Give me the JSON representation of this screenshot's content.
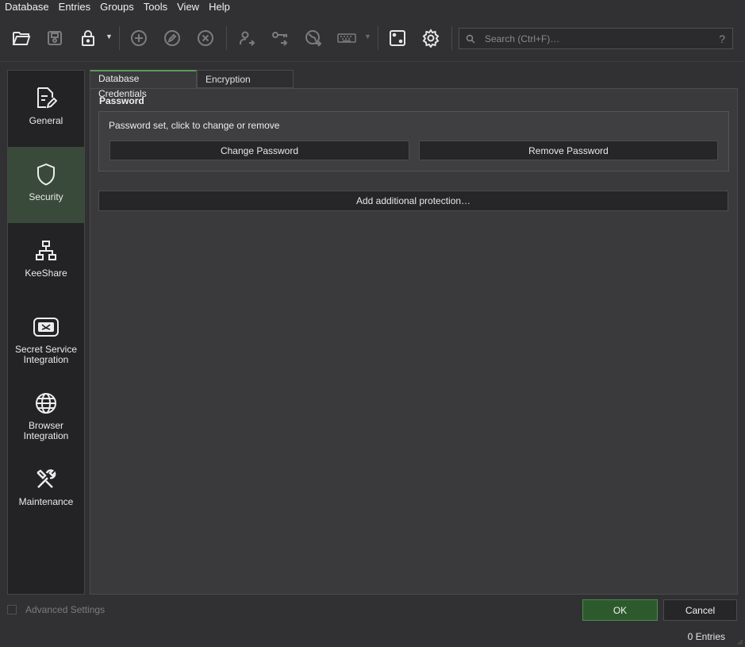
{
  "menu": [
    "Database",
    "Entries",
    "Groups",
    "Tools",
    "View",
    "Help"
  ],
  "toolbar": {
    "icons": [
      "open-database-icon",
      "save-database-icon",
      "lock-database-icon",
      "add-entry-icon",
      "edit-entry-icon",
      "delete-entry-icon",
      "copy-username-icon",
      "copy-password-icon",
      "open-url-icon",
      "autotype-icon",
      "password-generator-icon",
      "settings-icon"
    ],
    "search_placeholder": "Search (Ctrl+F)…",
    "help": "?"
  },
  "sidebar": {
    "items": [
      {
        "label": "General",
        "icon": "document-edit-icon"
      },
      {
        "label": "Security",
        "icon": "shield-icon",
        "active": true
      },
      {
        "label": "KeeShare",
        "icon": "network-icon"
      },
      {
        "label": "Secret Service Integration",
        "icon": "secret-service-icon"
      },
      {
        "label": "Browser Integration",
        "icon": "globe-icon"
      },
      {
        "label": "Maintenance",
        "icon": "tools-icon"
      }
    ]
  },
  "tabs": [
    {
      "label": "Database Credentials",
      "active": true
    },
    {
      "label": "Encryption Settings",
      "active": false
    }
  ],
  "password": {
    "title": "Password",
    "status": "Password set, click to change or remove",
    "change_label": "Change Password",
    "remove_label": "Remove Password"
  },
  "add_protection_label": "Add additional protection…",
  "advanced_settings_label": "Advanced Settings",
  "ok_label": "OK",
  "cancel_label": "Cancel",
  "status_text": "0 Entries",
  "colors": {
    "accent": "#5b9a5b",
    "ok_bg": "#2d5a2d",
    "active_side": "#3a4a3a"
  }
}
